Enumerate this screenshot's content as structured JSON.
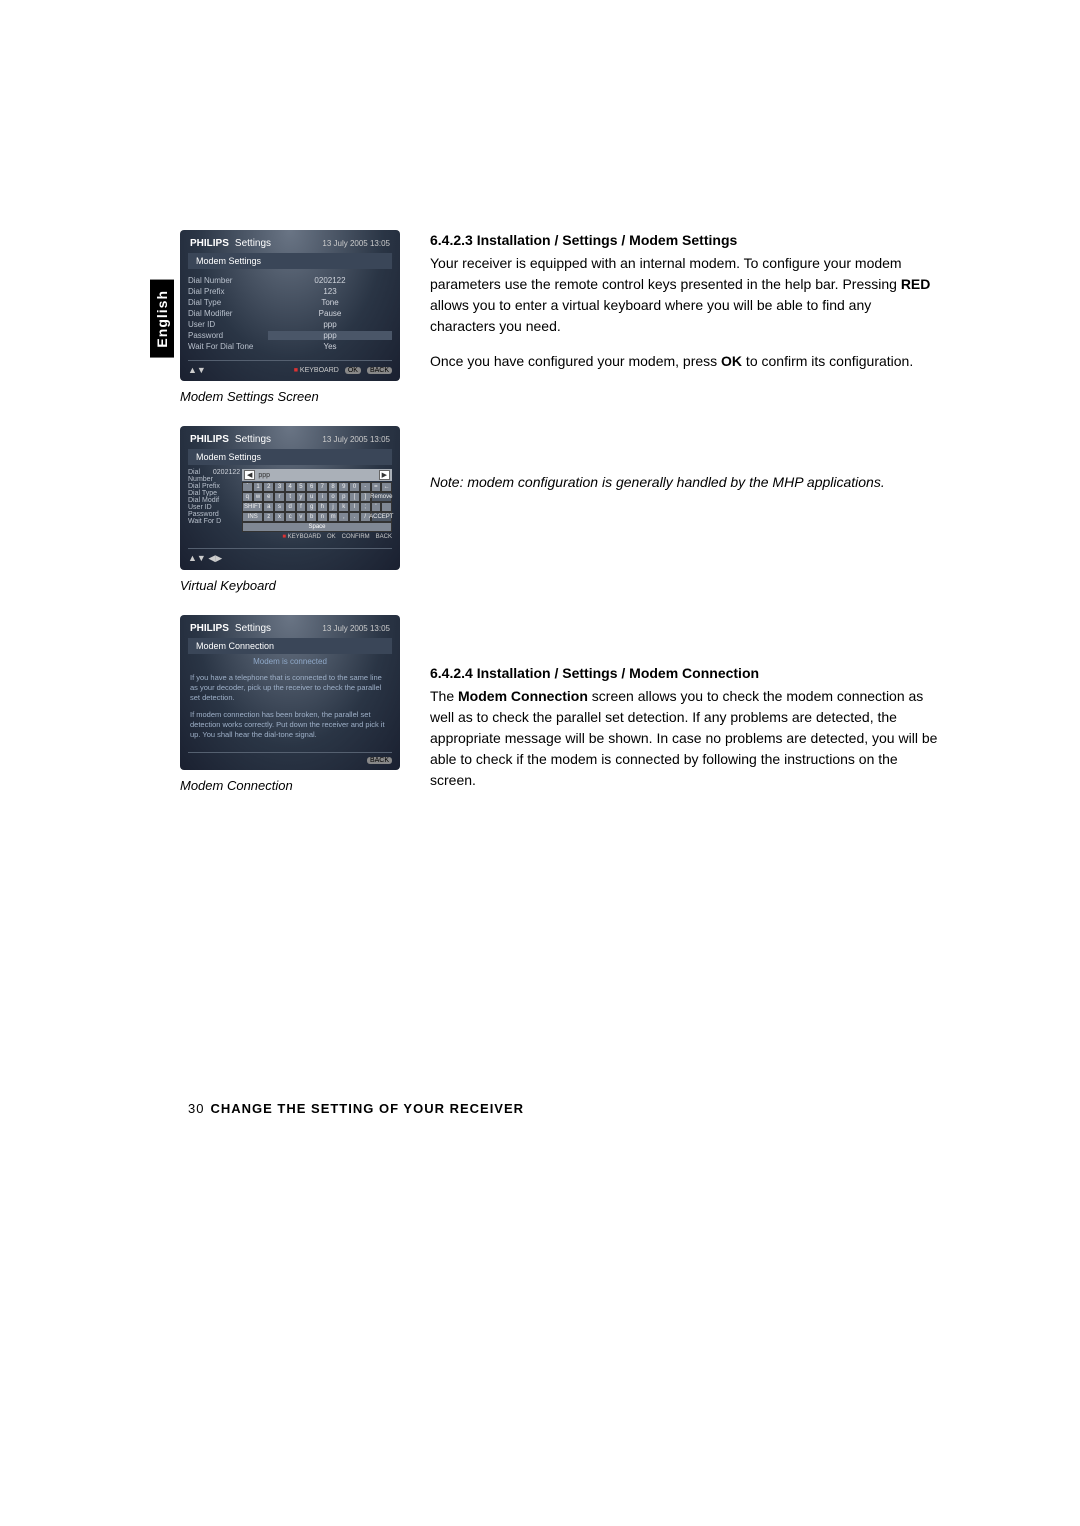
{
  "sidebar_tab": "English",
  "screenshot1": {
    "brand": "PHILIPS",
    "title": "Settings",
    "timestamp": "13 July 2005   13:05",
    "subheader": "Modem Settings",
    "rows": [
      {
        "label": "Dial Number",
        "value": "0202122"
      },
      {
        "label": "Dial Prefix",
        "value": "123"
      },
      {
        "label": "Dial Type",
        "value": "Tone"
      },
      {
        "label": "Dial Modifier",
        "value": "Pause"
      },
      {
        "label": "User ID",
        "value": "ppp"
      },
      {
        "label": "Password",
        "value": "ppp"
      },
      {
        "label": "Wait For Dial Tone",
        "value": "Yes"
      }
    ],
    "footer": {
      "keyboard": "KEYBOARD",
      "ok": "OK",
      "back": "BACK"
    }
  },
  "caption1": "Modem Settings Screen",
  "screenshot2": {
    "brand": "PHILIPS",
    "title": "Settings",
    "timestamp": "13 July 2005   13:05",
    "subheader": "Modem Settings",
    "side_labels": [
      "Dial Number",
      "Dial Prefix",
      "Dial Type",
      "Dial Modif",
      "User ID",
      "Password",
      "Wait For D"
    ],
    "dial_value": "0202122",
    "vk_text": "ppp",
    "vk_rows": [
      [
        "`",
        "1",
        "2",
        "3",
        "4",
        "5",
        "6",
        "7",
        "8",
        "9",
        "0",
        "-",
        "=",
        "←"
      ],
      [
        "q",
        "w",
        "e",
        "r",
        "t",
        "y",
        "u",
        "i",
        "o",
        "p",
        "[",
        "]",
        "Remove"
      ],
      [
        "SHIFT",
        "a",
        "s",
        "d",
        "f",
        "g",
        "h",
        "j",
        "k",
        "l",
        ";",
        "'",
        ""
      ],
      [
        "INS",
        "z",
        "x",
        "c",
        "v",
        "b",
        "n",
        "m",
        ",",
        ".",
        "/",
        "ACCEPT"
      ]
    ],
    "space": "Space",
    "footer": {
      "keyboard": "KEYBOARD",
      "ok": "OK",
      "confirm": "CONFIRM",
      "back": "BACK"
    }
  },
  "caption2": "Virtual Keyboard",
  "screenshot3": {
    "brand": "PHILIPS",
    "title": "Settings",
    "timestamp": "13 July 2005   13:05",
    "subheader": "Modem Connection",
    "status": "Modem is connected",
    "para1": "If you have a telephone that is connected to the same line as your decoder, pick up the receiver to check the parallel set detection.",
    "para2": "If modem connection has been broken, the parallel set detection works correctly. Put down the receiver and pick it up. You shall hear the dial-tone signal.",
    "footer": {
      "back": "BACK"
    }
  },
  "caption3": "Modem Connection",
  "sec1": {
    "heading": "6.4.2.3 Installation / Settings / Modem Settings",
    "p1a": "Your receiver is equipped with an internal modem. To configure your modem parameters use the remote control keys presented in the help bar. Pressing ",
    "p1_bold1": "RED",
    "p1b": " allows you to enter a virtual keyboard where you will be able to find any characters you need.",
    "p2a": "Once you have configured your modem, press ",
    "p2_bold1": "OK",
    "p2b": " to confirm its configuration.",
    "note": "Note: modem configuration is generally handled by the MHP applications."
  },
  "sec2": {
    "heading": "6.4.2.4 Installation / Settings / Modem Connection",
    "p1a": "The ",
    "p1_bold1": "Modem Connection",
    "p1b": " screen allows you to check the modem connection as well as to check the parallel set detection. If any problems are detected, the appropriate message will be shown. In case  no problems are detected, you will be able to check if the modem is connected by following the instructions on the screen."
  },
  "page_footer": {
    "num": "30",
    "title": "CHANGE THE SETTING OF YOUR RECEIVER"
  }
}
